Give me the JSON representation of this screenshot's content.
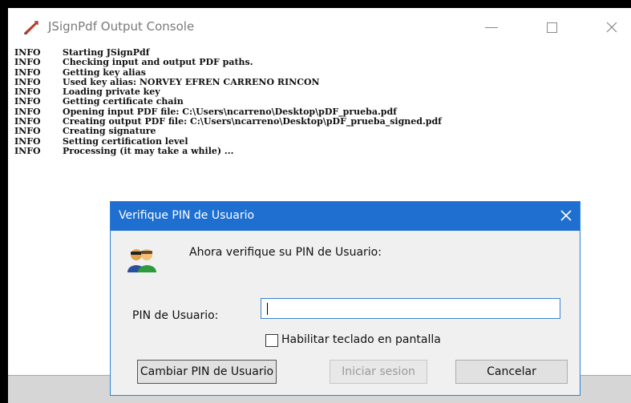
{
  "console": {
    "title": "JSignPdf Output Console",
    "log": [
      {
        "level": "INFO",
        "message": "Starting JSignPdf"
      },
      {
        "level": "INFO",
        "message": "Checking input and output PDF paths."
      },
      {
        "level": "INFO",
        "message": "Getting key alias"
      },
      {
        "level": "INFO",
        "message": "Used key alias: NORVEY EFREN CARRENO RINCON"
      },
      {
        "level": "INFO",
        "message": "Loading private key"
      },
      {
        "level": "INFO",
        "message": "Getting certificate chain"
      },
      {
        "level": "INFO",
        "message": "Opening input PDF file: C:\\Users\\ncarreno\\Desktop\\pDF_prueba.pdf"
      },
      {
        "level": "INFO",
        "message": "Creating output PDF file: C:\\Users\\ncarreno\\Desktop\\pDF_prueba_signed.pdf"
      },
      {
        "level": "INFO",
        "message": "Creating signature"
      },
      {
        "level": "INFO",
        "message": "Setting certification level"
      },
      {
        "level": "INFO",
        "message": "Processing (it may take a while) ..."
      }
    ]
  },
  "dialog": {
    "title": "Verifique PIN de Usuario",
    "prompt": "Ahora verifique su PIN de Usuario:",
    "pin_label": "PIN de Usuario:",
    "pin_value": "",
    "keyboard_label": "Habilitar teclado en pantalla",
    "keyboard_checked": false,
    "buttons": {
      "change_pin": "Cambiar PIN de Usuario",
      "login": "Iniciar sesion",
      "cancel": "Cancelar"
    }
  },
  "icons": {
    "app": "jsignpdf-app-icon",
    "users": "users-icon",
    "minimize": "minimize-icon",
    "maximize": "maximize-icon",
    "close": "close-icon"
  },
  "colors": {
    "dialog_title_bar": "#1e6fcf",
    "input_focus_border": "#3b82d0"
  }
}
